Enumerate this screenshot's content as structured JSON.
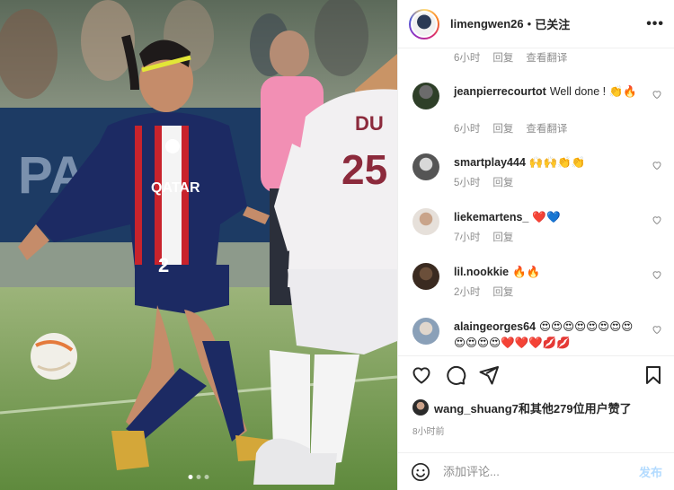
{
  "post": {
    "username": "limengwen26",
    "separator": "•",
    "follow_status": "已关注",
    "more_icon": "more-horizontal-icon"
  },
  "comments": [
    {
      "username": "",
      "text": "",
      "time": "6小时",
      "reply": "回复",
      "translate": "查看翻译"
    },
    {
      "username": "jeanpierrecourtot",
      "text": "Well done ! 👏🔥",
      "time": "6小时",
      "reply": "回复",
      "translate": "查看翻译"
    },
    {
      "username": "smartplay444",
      "text": "🙌🙌👏👏",
      "time": "5小时",
      "reply": "回复"
    },
    {
      "username": "liekemartens_",
      "text": "❤️💙",
      "time": "7小时",
      "reply": "回复"
    },
    {
      "username": "lil.nookkie",
      "text": "🔥🔥",
      "time": "2小时",
      "reply": "回复"
    },
    {
      "username": "alaingeorges64",
      "text": "😍😍😍😍😍😍😍😍😍😍😍😍❤️❤️❤️💋💋"
    }
  ],
  "likes": {
    "text": "wang_shuang7和其他279位用户赞了"
  },
  "timestamp": "8小时前",
  "input": {
    "placeholder": "添加评论...",
    "post_label": "发布"
  },
  "colors": {
    "accent_blue": "#0095f6",
    "muted": "#8e8e8e",
    "post_disabled": "#b3dbff"
  },
  "icons": [
    "heart-icon",
    "comment-icon",
    "share-icon",
    "bookmark-icon",
    "emoji-icon"
  ]
}
